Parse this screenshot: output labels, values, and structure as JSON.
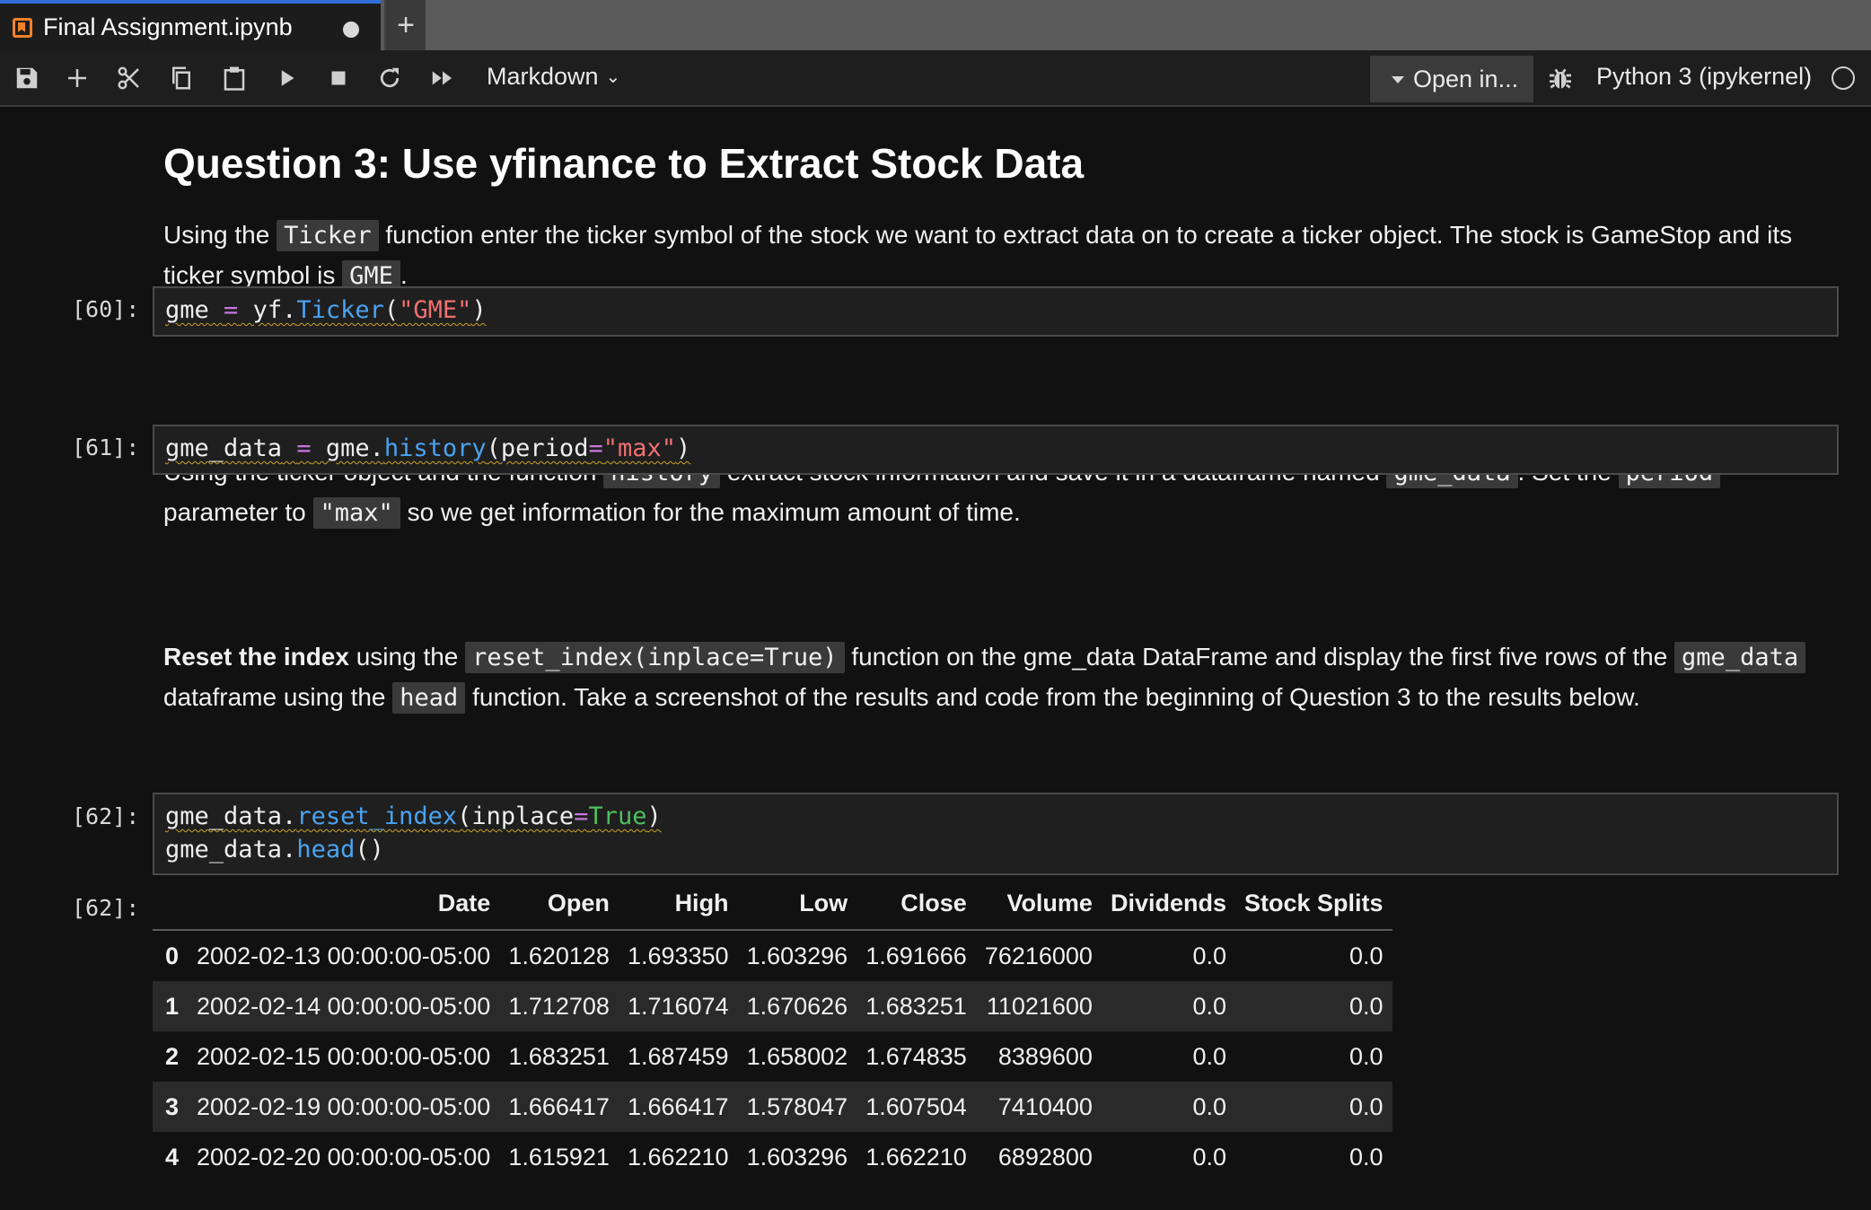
{
  "tab": {
    "title": "Final Assignment.ipynb",
    "add_label": "+"
  },
  "toolbar": {
    "cell_type": "Markdown",
    "open_in": "Open in...",
    "kernel": "Python 3 (ipykernel)"
  },
  "md1": {
    "heading": "Question 3: Use yfinance to Extract Stock Data",
    "p1": "Using the ",
    "c1": "Ticker",
    "p2": " function enter the ticker symbol of the stock we want to extract data on to create a ticker object. The stock is GameStop and its ticker symbol is ",
    "c2": "GME",
    "p3": "."
  },
  "cell60": {
    "prompt": "[60]:",
    "t1": "gme",
    "t2": " ",
    "t3": "=",
    "t4": " yf.",
    "t5": "Ticker",
    "t6": "(",
    "t7": "\"GME\"",
    "t8": ")"
  },
  "md2": {
    "p1": "Using the ticker object and the function ",
    "c1": "history",
    "p2": " extract stock information and save it in a dataframe named ",
    "c2": "gme_data",
    "p3": ". Set the ",
    "c3": "period",
    "p4": " parameter to ",
    "c4": "\"max\"",
    "p5": " so we get information for the maximum amount of time."
  },
  "cell61": {
    "prompt": "[61]:",
    "t1": "gme_data",
    "t2": " ",
    "t3": "=",
    "t4": " gme.",
    "t5": "history",
    "t6": "(period",
    "t7": "=",
    "t8": "\"max\"",
    "t9": ")"
  },
  "md3": {
    "b1": "Reset the index",
    "p1": " using the ",
    "c1": "reset_index(inplace=True)",
    "p2": " function on the gme_data DataFrame and display the first five rows of the ",
    "c2": "gme_data",
    "p3": " dataframe using the ",
    "c3": "head",
    "p4": " function. Take a screenshot of the results and code from the beginning of Question 3 to the results below."
  },
  "cell62": {
    "prompt": "[62]:",
    "l1a": "gme_data.",
    "l1b": "reset_index",
    "l1c": "(inplace",
    "l1d": "=",
    "l1e": "True",
    "l1f": ")",
    "l2a": "gme_data.",
    "l2b": "head",
    "l2c": "()",
    "out_prompt": "[62]:"
  },
  "table": {
    "columns": [
      "",
      "Date",
      "Open",
      "High",
      "Low",
      "Close",
      "Volume",
      "Dividends",
      "Stock Splits"
    ],
    "rows": [
      [
        "0",
        "2002-02-13 00:00:00-05:00",
        "1.620128",
        "1.693350",
        "1.603296",
        "1.691666",
        "76216000",
        "0.0",
        "0.0"
      ],
      [
        "1",
        "2002-02-14 00:00:00-05:00",
        "1.712708",
        "1.716074",
        "1.670626",
        "1.683251",
        "11021600",
        "0.0",
        "0.0"
      ],
      [
        "2",
        "2002-02-15 00:00:00-05:00",
        "1.683251",
        "1.687459",
        "1.658002",
        "1.674835",
        "8389600",
        "0.0",
        "0.0"
      ],
      [
        "3",
        "2002-02-19 00:00:00-05:00",
        "1.666417",
        "1.666417",
        "1.578047",
        "1.607504",
        "7410400",
        "0.0",
        "0.0"
      ],
      [
        "4",
        "2002-02-20 00:00:00-05:00",
        "1.615921",
        "1.662210",
        "1.603296",
        "1.662210",
        "6892800",
        "0.0",
        "0.0"
      ]
    ]
  },
  "colors": {
    "background": "#111111",
    "tab_accent": "#2f6fd6",
    "notebook_icon": "#f08228",
    "operator": "#c678dd",
    "function": "#4aa3f0",
    "string": "#f07070",
    "keyword_true": "#4fbf5f"
  }
}
